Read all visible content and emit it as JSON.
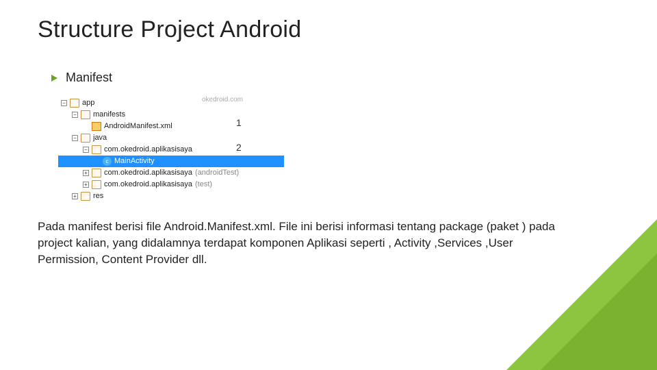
{
  "title": "Structure Project Android",
  "bullet": "Manifest",
  "tree": {
    "watermark": "okedroid.com",
    "rows": [
      {
        "toggle": "−",
        "icon": "folder",
        "label": "app",
        "indent": 1
      },
      {
        "toggle": "−",
        "icon": "folder",
        "label": "manifests",
        "indent": 2
      },
      {
        "toggle": "",
        "icon": "file-orange",
        "label": "AndroidManifest.xml",
        "indent": 3
      },
      {
        "toggle": "−",
        "icon": "folder",
        "label": "java",
        "indent": 2
      },
      {
        "toggle": "−",
        "icon": "folder",
        "label": "com.okedroid.aplikasisaya",
        "indent": 3
      },
      {
        "toggle": "",
        "icon": "circ",
        "label": "MainActivity",
        "indent": 4,
        "selected": true
      },
      {
        "toggle": "+",
        "icon": "folder",
        "label": "com.okedroid.aplikasisaya",
        "indent": 3,
        "suffix": "(androidTest)"
      },
      {
        "toggle": "+",
        "icon": "folder",
        "label": "com.okedroid.aplikasisaya",
        "indent": 3,
        "suffix": "(test)"
      },
      {
        "toggle": "+",
        "icon": "folder",
        "label": "res",
        "indent": 2
      }
    ],
    "annotations": {
      "one": "1",
      "two": "2"
    }
  },
  "paragraph": "Pada manifest berisi file Android.Manifest.xml. File ini berisi informasi tentang package (paket ) pada project kalian, yang didalamnya terdapat komponen Aplikasi seperti , Activity ,Services ,User Permission, Content Provider dll."
}
